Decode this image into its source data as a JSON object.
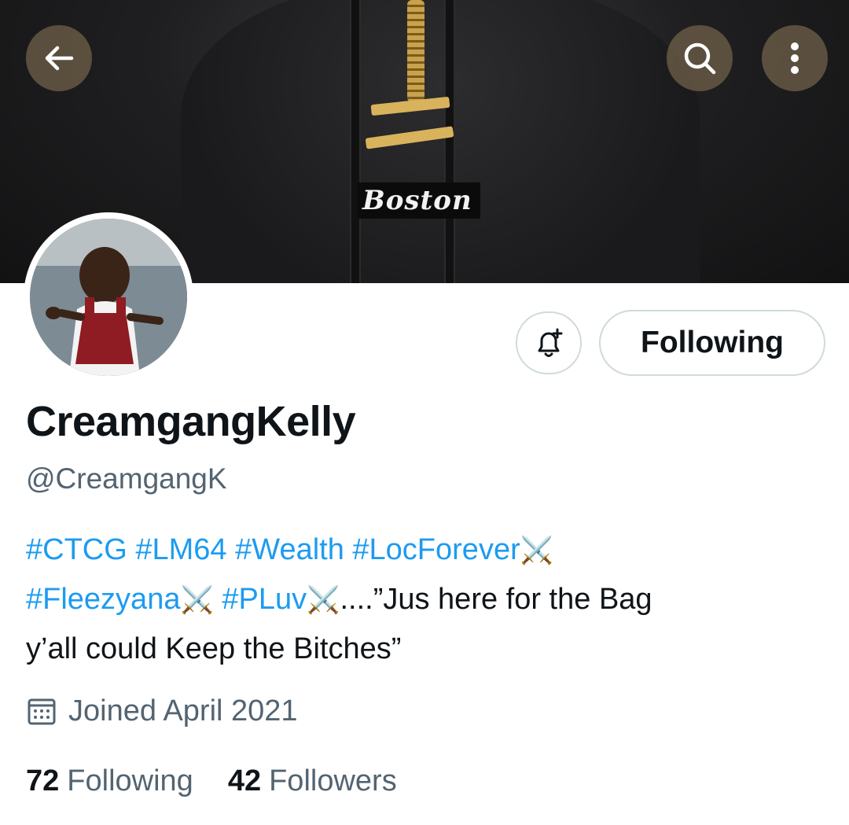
{
  "header": {
    "back_icon": "arrow-left-icon",
    "search_icon": "search-icon",
    "more_icon": "more-vertical-icon",
    "banner_text": "Boston"
  },
  "actions": {
    "notify_icon": "bell-plus-icon",
    "follow_label": "Following"
  },
  "profile": {
    "display_name": "CreamgangKelly",
    "handle": "@CreamgangK",
    "bio": {
      "tags_line1": [
        "#CTCG",
        "#LM64",
        "#Wealth",
        "#LocForever"
      ],
      "tag_fleezyana": "#Fleezyana",
      "tag_pluv": "#PLuv",
      "sword": "⚔️",
      "quote_part1": "....”Jus here for the Bag",
      "quote_part2": "y’all could Keep the Bitches”"
    },
    "joined": "Joined April 2021",
    "following_count": "72",
    "following_label": "Following",
    "followers_count": "42",
    "followers_label": "Followers"
  },
  "colors": {
    "link": "#1d9bf0",
    "secondary_text": "#536471",
    "primary_text": "#0f1419",
    "button_border": "#cfd9de"
  }
}
